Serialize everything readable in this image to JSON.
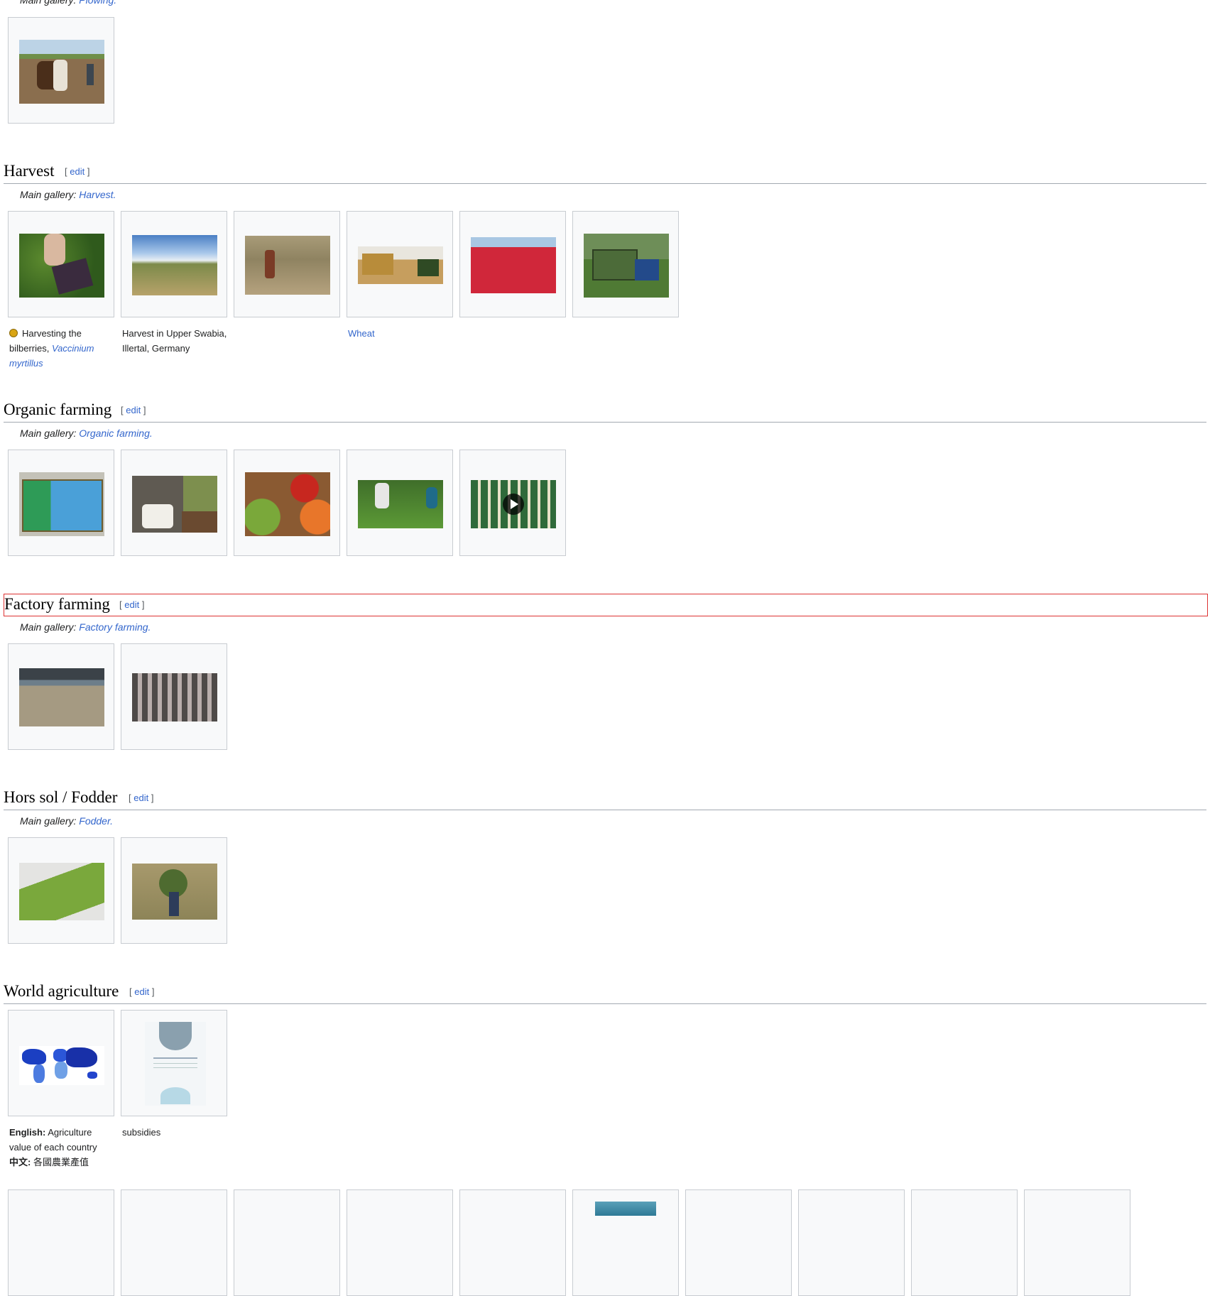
{
  "sections": {
    "plowing": {
      "main_gallery_prefix": "Main gallery:",
      "main_gallery_link": "Plowing."
    },
    "harvest": {
      "title": "Harvest",
      "edit_open": "[",
      "edit_label": "edit",
      "edit_close": "]",
      "main_gallery_prefix": "Main gallery:",
      "main_gallery_link": "Harvest.",
      "captions": {
        "c1_text": "Harvesting the bilberries,",
        "c1_link": "Vaccinium myrtillus",
        "c2": "Harvest in Upper Swabia, Illertal, Germany",
        "c4_link": "Wheat"
      }
    },
    "organic": {
      "title": "Organic farming",
      "edit_open": "[",
      "edit_label": "edit",
      "edit_close": "]",
      "main_gallery_prefix": "Main gallery:",
      "main_gallery_link": "Organic farming."
    },
    "factory": {
      "title": "Factory farming",
      "edit_open": "[",
      "edit_label": "edit",
      "edit_close": "]",
      "main_gallery_prefix": "Main gallery:",
      "main_gallery_link": "Factory farming."
    },
    "fodder": {
      "title": "Hors sol / Fodder",
      "edit_open": "[",
      "edit_label": "edit",
      "edit_close": "]",
      "main_gallery_prefix": "Main gallery:",
      "main_gallery_link": "Fodder."
    },
    "world": {
      "title": "World agriculture",
      "edit_open": "[",
      "edit_label": "edit",
      "edit_close": "]",
      "captions": {
        "c1_en_label": "English:",
        "c1_en_text": "Agriculture value of each country",
        "c1_zh_label": "中文:",
        "c1_zh_text": "各國農業產值",
        "c2": "subsidies"
      }
    }
  },
  "icons": {
    "play": "play-icon",
    "quality_badge": "quality-image-badge-icon"
  },
  "colors": {
    "link": "#3366cc",
    "highlight_border": "#dd3333",
    "thumb_border": "#c8ccd1",
    "thumb_bg": "#f8f9fa"
  }
}
